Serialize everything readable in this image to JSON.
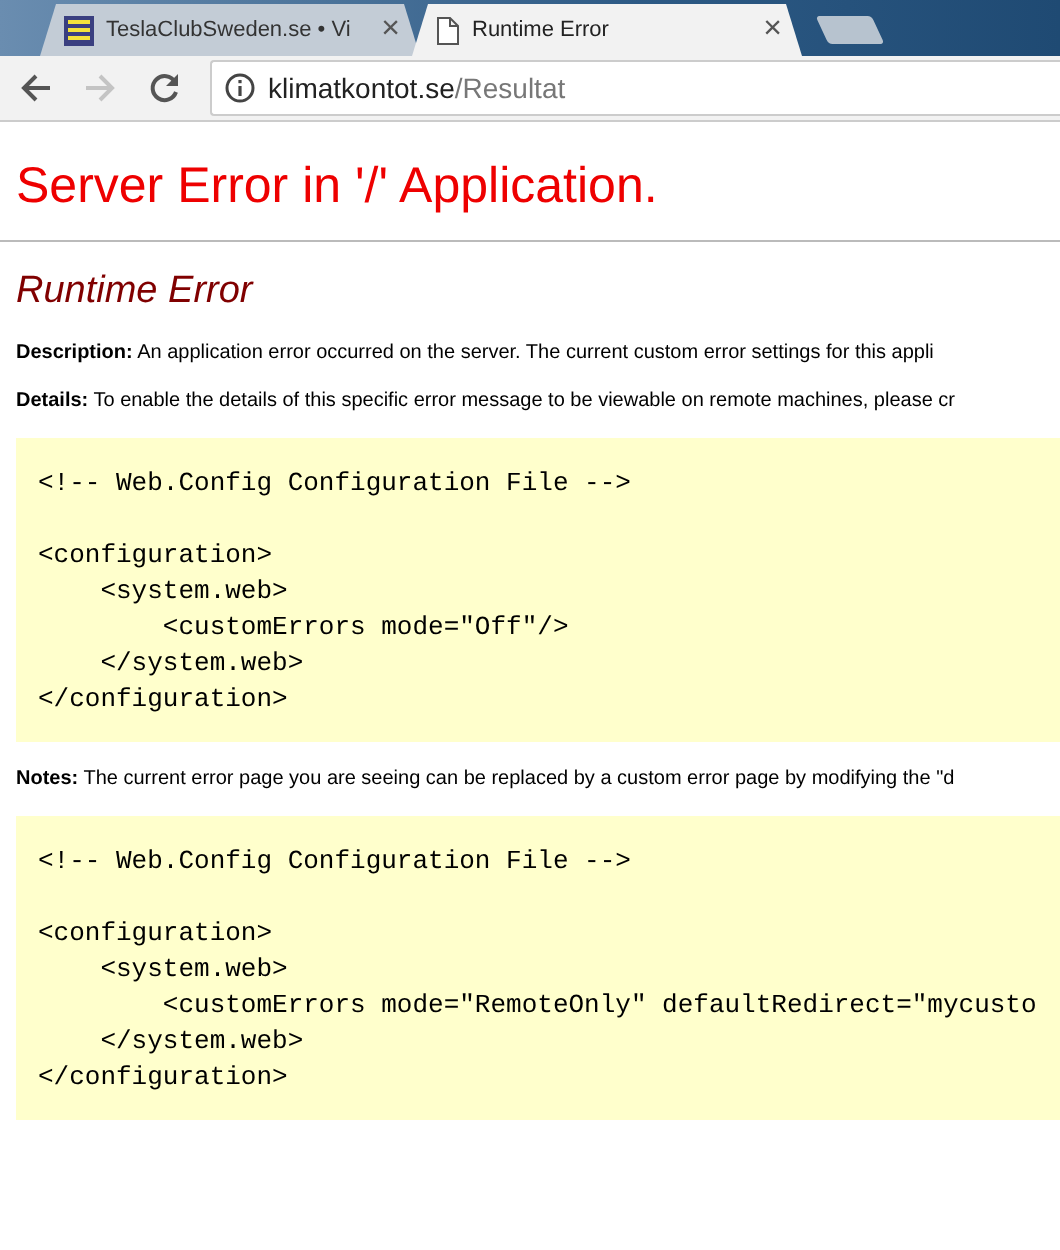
{
  "tabs": [
    {
      "title": "TeslaClubSweden.se • Vi",
      "close": "×",
      "selected": false,
      "kind": "favicon"
    },
    {
      "title": "Runtime Error",
      "close": "×",
      "selected": true,
      "kind": "page"
    }
  ],
  "address_bar": {
    "host": "klimatkontot.se",
    "path": "/Resultat"
  },
  "page": {
    "heading": "Server Error in '/' Application.",
    "subheading": "Runtime Error",
    "sections": [
      {
        "label": "Description:",
        "text": "An application error occurred on the server. The current custom error settings for this appli"
      },
      {
        "label": "Details:",
        "text": "To enable the details of this specific error message to be viewable on remote machines, please cr",
        "code": "<!-- Web.Config Configuration File -->\n\n<configuration>\n    <system.web>\n        <customErrors mode=\"Off\"/>\n    </system.web>\n</configuration>"
      },
      {
        "label": "Notes:",
        "text": "The current error page you are seeing can be replaced by a custom error page by modifying the \"d",
        "code": "<!-- Web.Config Configuration File -->\n\n<configuration>\n    <system.web>\n        <customErrors mode=\"RemoteOnly\" defaultRedirect=\"mycusto\n    </system.web>\n</configuration>"
      }
    ]
  }
}
